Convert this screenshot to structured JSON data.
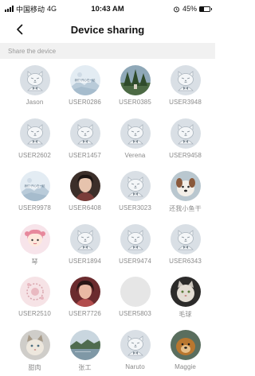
{
  "status_bar": {
    "carrier": "中国移动",
    "network": "4G",
    "time": "10:43 AM",
    "battery": "45%",
    "battery_level": 0.45
  },
  "header": {
    "title": "Device sharing",
    "back_icon": "chevron-left-icon"
  },
  "section": {
    "label": "Share the device"
  },
  "users": [
    {
      "name": "Jason",
      "avatar": "cat"
    },
    {
      "name": "USER0286",
      "avatar": "landscape",
      "caption": "我们·开心在一起"
    },
    {
      "name": "USER0385",
      "avatar": "photo-trees"
    },
    {
      "name": "USER3948",
      "avatar": "cat"
    },
    {
      "name": "USER2602",
      "avatar": "cat"
    },
    {
      "name": "USER1457",
      "avatar": "cat"
    },
    {
      "name": "Verena",
      "avatar": "cat"
    },
    {
      "name": "USER9458",
      "avatar": "cat"
    },
    {
      "name": "USER9978",
      "avatar": "landscape",
      "caption": "我们·开心在一起"
    },
    {
      "name": "USER6408",
      "avatar": "photo-portrait"
    },
    {
      "name": "USER3023",
      "avatar": "cat"
    },
    {
      "name": "还我小鱼干",
      "avatar": "photo-dog"
    },
    {
      "name": "琴",
      "avatar": "cartoon-girl"
    },
    {
      "name": "USER1894",
      "avatar": "cat"
    },
    {
      "name": "USER9474",
      "avatar": "cat"
    },
    {
      "name": "USER6343",
      "avatar": "cat"
    },
    {
      "name": "USER2510",
      "avatar": "photo-pink"
    },
    {
      "name": "USER7726",
      "avatar": "photo-portrait-2"
    },
    {
      "name": "USER5803",
      "avatar": "blank"
    },
    {
      "name": "毛球",
      "avatar": "photo-cat"
    },
    {
      "name": "甜肉",
      "avatar": "photo-cat-2"
    },
    {
      "name": "张工",
      "avatar": "photo-lake"
    },
    {
      "name": "Naruto",
      "avatar": "cat"
    },
    {
      "name": "Maggie",
      "avatar": "photo-dog-2"
    }
  ],
  "colors": {
    "accent_avatar_bg": "#d9dfe5",
    "label_text": "#8a8a8a",
    "section_bg": "#f1f1f1"
  }
}
